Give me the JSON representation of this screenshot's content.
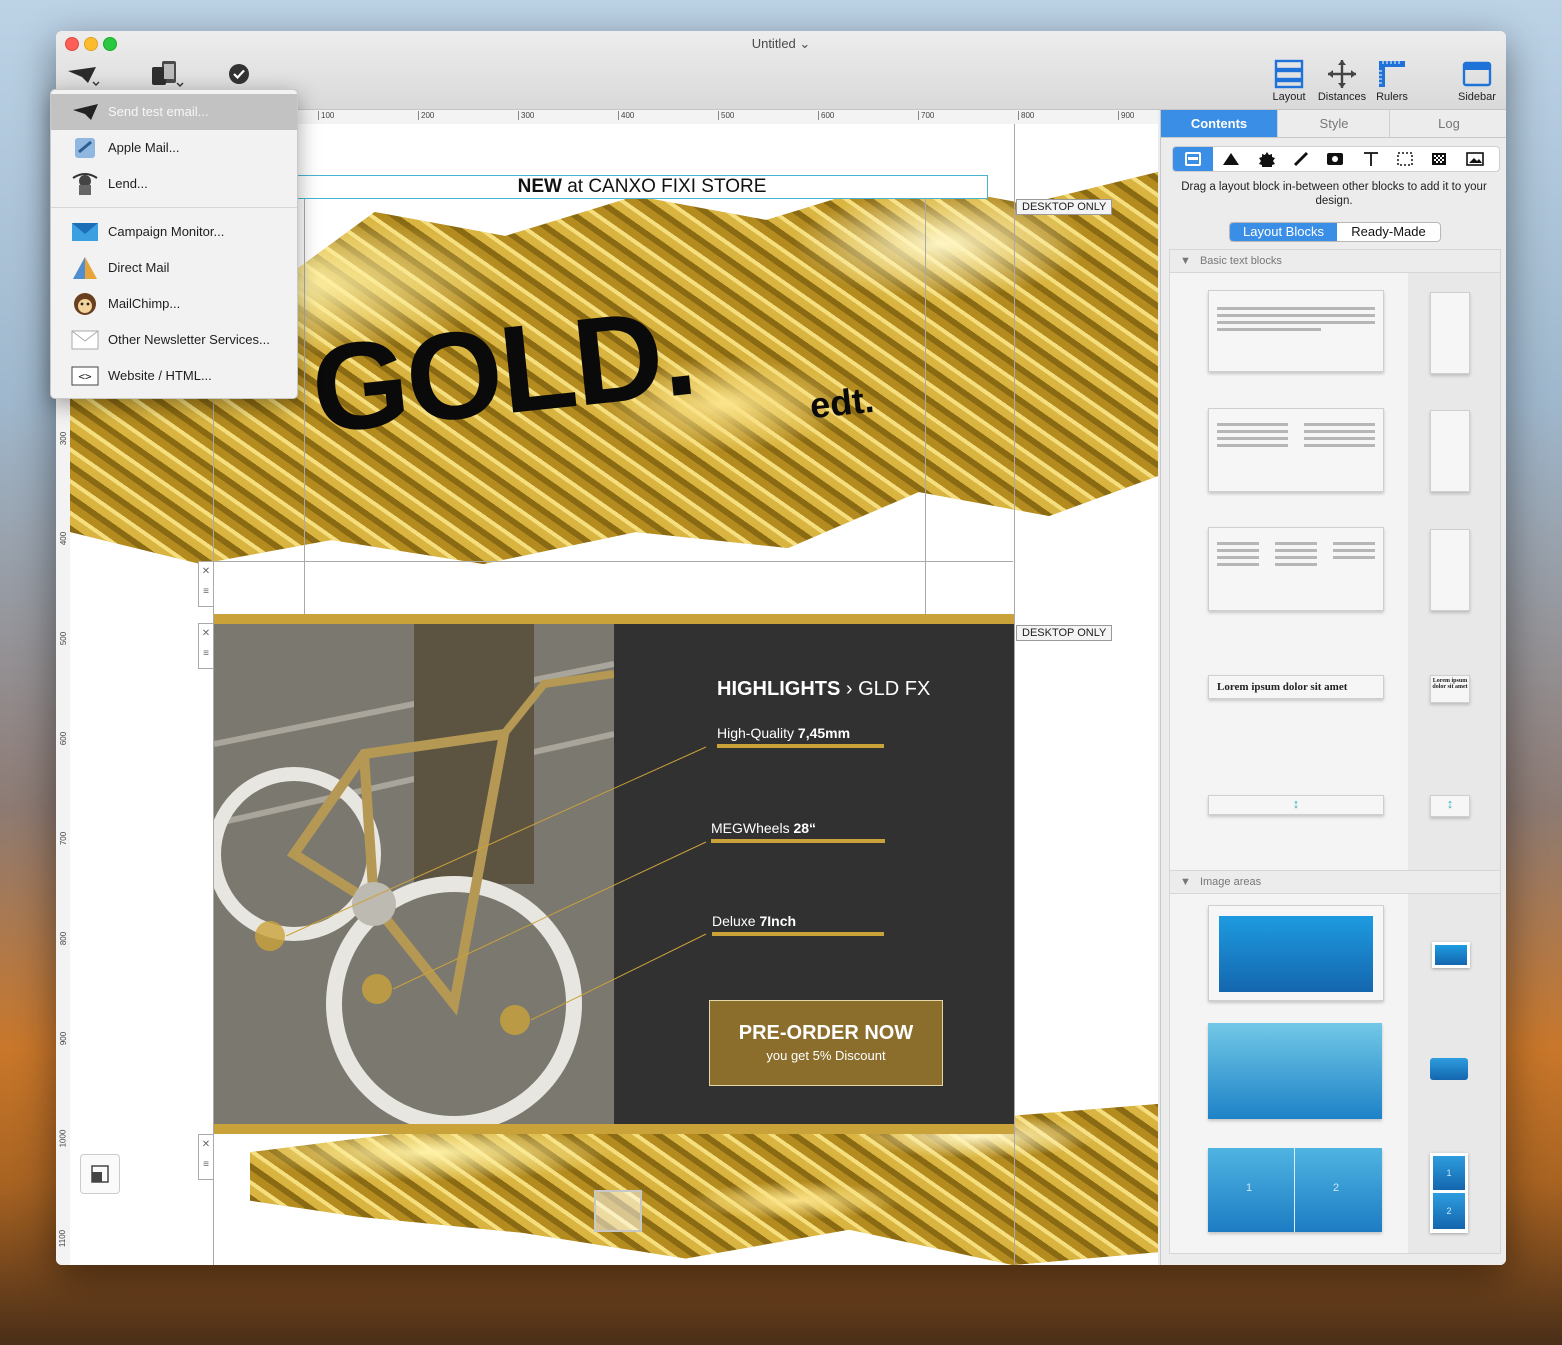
{
  "window": {
    "title": "Untitled"
  },
  "toolbar": {
    "layout_label": "Layout",
    "distances_label": "Distances",
    "rulers_label": "Rulers",
    "sidebar_label": "Sidebar"
  },
  "send_menu": {
    "items": [
      {
        "label": "Send test email...",
        "icon": "paper-plane-icon"
      },
      {
        "label": "Apple Mail...",
        "icon": "apple-mail-icon"
      },
      {
        "label": "Lend...",
        "icon": "lend-icon"
      },
      {
        "label": "Campaign Monitor...",
        "icon": "campaign-monitor-icon"
      },
      {
        "label": "Direct Mail",
        "icon": "direct-mail-icon"
      },
      {
        "label": "MailChimp...",
        "icon": "mailchimp-icon"
      },
      {
        "label": "Other Newsletter Services...",
        "icon": "envelope-icon"
      },
      {
        "label": "Website / HTML...",
        "icon": "code-icon"
      }
    ]
  },
  "ruler": {
    "h_ticks": [
      "100",
      "200",
      "300",
      "400",
      "500",
      "600",
      "700",
      "800",
      "900"
    ],
    "v_ticks": [
      "300",
      "400",
      "500",
      "600",
      "700",
      "800",
      "900",
      "1000",
      "1100"
    ]
  },
  "design": {
    "preheader_bold": "NEW",
    "preheader_rest": " at CANXO FIXI STORE",
    "desktop_only": "DESKTOP ONLY",
    "hero_title": "GOLD.",
    "hero_sub": "edt.",
    "highlights_bold": "HIGHLIGHTS",
    "highlights_rest": " › GLD  FX",
    "features": [
      {
        "name": "High-Quality ",
        "value": "7,45mm"
      },
      {
        "name": "MEGWheels ",
        "value": "28“"
      },
      {
        "name": "Deluxe  ",
        "value": "7Inch"
      }
    ],
    "cta_title": "PRE-ORDER NOW",
    "cta_sub": "you get 5% Discount"
  },
  "sidebar": {
    "tabs": [
      "Contents",
      "Style",
      "Log"
    ],
    "hint": "Drag a layout block in-between other blocks to add it to your design.",
    "segments": [
      "Layout Blocks",
      "Ready-Made"
    ],
    "section_text": "Basic text blocks",
    "section_image": "Image areas",
    "lorem": "Lorem ipsum dolor sit amet",
    "lorem_small": "Lorem ipsum dolor sit amet",
    "col_numbers": [
      "1",
      "2"
    ]
  },
  "colors": {
    "accent_blue": "#3a8ee6",
    "gold_bar": "#caa23a",
    "dark_panel": "#313131",
    "cta_bg": "#8c6e2c"
  }
}
